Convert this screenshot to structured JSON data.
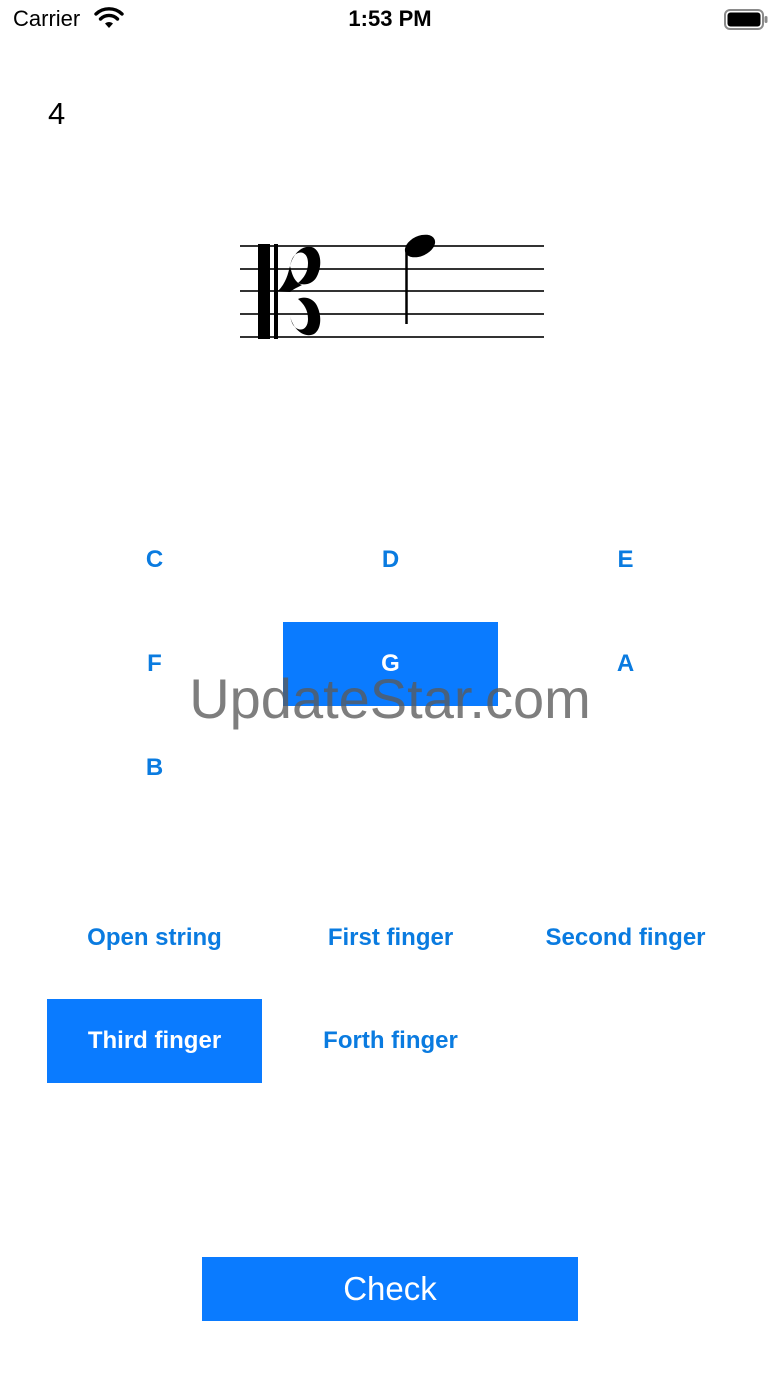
{
  "status_bar": {
    "carrier": "Carrier",
    "time": "1:53 PM",
    "icons": [
      "wifi-icon",
      "battery-icon"
    ]
  },
  "counter": "4",
  "staff": {
    "clef": "alto-clef",
    "note": "quarter-note"
  },
  "notes": [
    {
      "label": "C",
      "selected": false
    },
    {
      "label": "D",
      "selected": false
    },
    {
      "label": "E",
      "selected": false
    },
    {
      "label": "F",
      "selected": false
    },
    {
      "label": "G",
      "selected": true
    },
    {
      "label": "A",
      "selected": false
    },
    {
      "label": "B",
      "selected": false
    }
  ],
  "fingers": [
    {
      "label": "Open string",
      "selected": false
    },
    {
      "label": "First finger",
      "selected": false
    },
    {
      "label": "Second finger",
      "selected": false
    },
    {
      "label": "Third finger",
      "selected": true
    },
    {
      "label": "Forth finger",
      "selected": false
    }
  ],
  "check_label": "Check",
  "watermark": "UpdateStar.com",
  "colors": {
    "accent": "#0a7bff",
    "accent_text": "#0a7be0"
  }
}
